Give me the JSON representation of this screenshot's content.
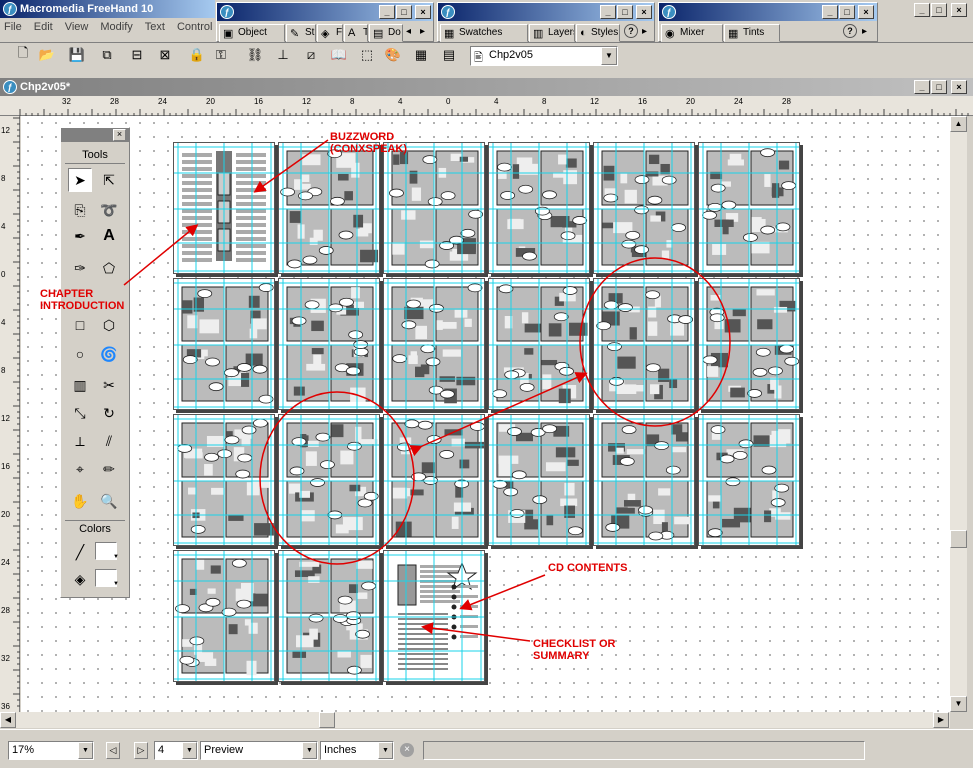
{
  "app": {
    "title": "Macromedia FreeHand 10"
  },
  "menu": [
    "File",
    "Edit",
    "View",
    "Modify",
    "Text",
    "Control"
  ],
  "panels": {
    "object": {
      "tabs": [
        {
          "label": "Object",
          "icon": "object-icon"
        },
        {
          "label": "St",
          "icon": "stroke-icon"
        },
        {
          "label": "Fi",
          "icon": "fill-icon"
        },
        {
          "label": "T",
          "icon": "text-icon"
        },
        {
          "label": "Do",
          "icon": "document-icon"
        }
      ]
    },
    "swatches": {
      "tabs": [
        {
          "label": "Swatches",
          "icon": "swatches-icon"
        },
        {
          "label": "Layers",
          "icon": "layers-icon"
        },
        {
          "label": "Styles",
          "icon": "styles-icon"
        }
      ]
    },
    "mixer": {
      "tabs": [
        {
          "label": "Mixer",
          "icon": "mixer-icon"
        },
        {
          "label": "Tints",
          "icon": "tints-icon"
        }
      ]
    }
  },
  "toolbar": {
    "style_value": "Chp2v05"
  },
  "document": {
    "title": "Chp2v05*"
  },
  "ruler": {
    "top": [
      "32",
      "28",
      "24",
      "20",
      "16",
      "12",
      "8",
      "4",
      "0",
      "4",
      "8",
      "12",
      "16",
      "20",
      "24",
      "28"
    ],
    "left": [
      "12",
      "8",
      "4",
      "0",
      "4",
      "8",
      "12",
      "16",
      "20",
      "24",
      "28",
      "32",
      "36"
    ]
  },
  "tools_panel": {
    "title": "Tools",
    "colors_label": "Colors"
  },
  "annotations": {
    "buzzword": "BUZZWORD\n(CONXSPEAK)",
    "chapter_intro": "CHAPTER\nINTRODUCTION",
    "cd_contents": "CD CONTENTS",
    "checklist": "CHECKLIST OR\nSUMMARY"
  },
  "statusbar": {
    "zoom": "17%",
    "page": "4",
    "view_mode": "Preview",
    "units": "Inches"
  },
  "colors": {
    "accent_red": "#e00000",
    "guide_cyan": "#1ad3e8",
    "titlebar": "#0a246a"
  }
}
